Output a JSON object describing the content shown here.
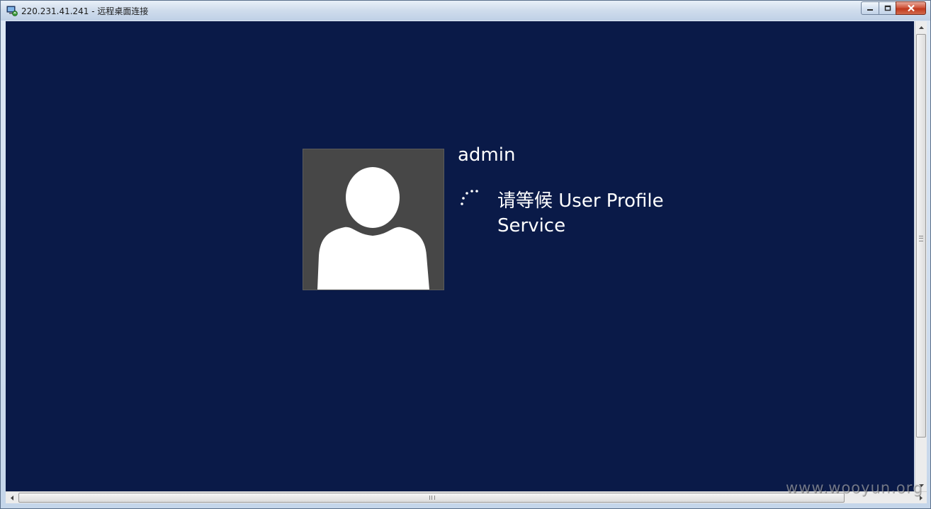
{
  "window": {
    "title": "220.231.41.241 - 远程桌面连接",
    "icon": "remote-desktop-icon",
    "buttons": [
      "minimize-icon",
      "maximize-icon",
      "close-icon"
    ]
  },
  "login": {
    "username": "admin",
    "status": "请等候 User Profile Service",
    "avatar_icon": "user-silhouette-icon",
    "spinner_icon": "loading-spinner-icon"
  },
  "colors": {
    "background": "#0a1a48",
    "avatar_bg": "#474747",
    "text": "#ffffff"
  },
  "watermark": "www.wooyun.org"
}
